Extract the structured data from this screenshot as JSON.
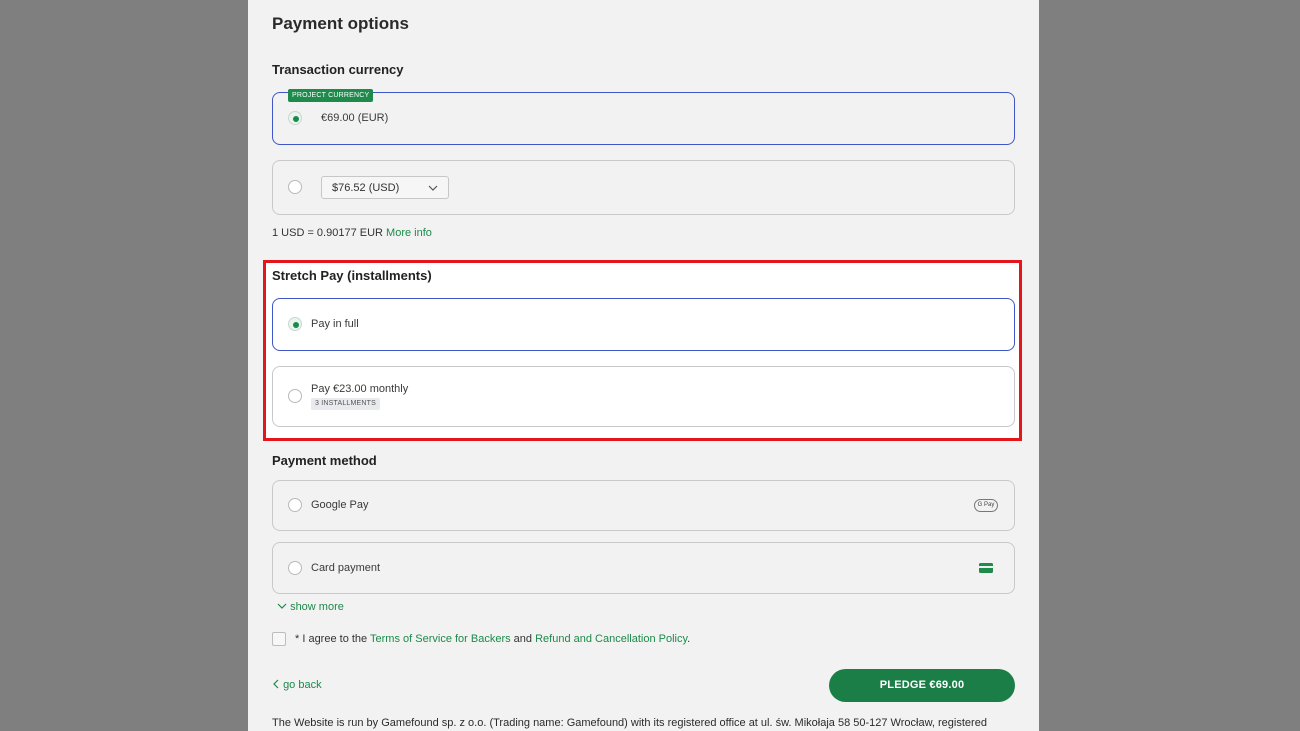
{
  "page": {
    "title": "Payment options",
    "transaction_currency": {
      "heading": "Transaction currency",
      "project_badge": "PROJECT CURRENCY",
      "option_eur": "€69.00 (EUR)",
      "option_usd_selected": "$76.52 (USD)",
      "rate_text": "1 USD = 0.90177 EUR",
      "more_info": "More info"
    },
    "stretch_pay": {
      "heading": "Stretch Pay (installments)",
      "full": "Pay in full",
      "monthly": "Pay €23.00 monthly",
      "installments_badge": "3 INSTALLMENTS"
    },
    "payment_method": {
      "heading": "Payment method",
      "google_pay": "Google Pay",
      "gpay_icon_text": "G Pay",
      "card_payment": "Card payment",
      "show_more": "show more"
    },
    "agreement": {
      "prefix": "* I agree to the ",
      "tos": "Terms of Service for Backers",
      "and": " and ",
      "refund": "Refund and Cancellation Policy",
      "suffix": "."
    },
    "actions": {
      "go_back": "go back",
      "pledge": "PLEDGE €69.00"
    },
    "footer": "The Website is run by Gamefound sp. z o.o. (Trading name: Gamefound) with its registered office at ul. św. Mikołaja 58 50-127 Wrocław, registered"
  },
  "colors": {
    "accent_green": "#1c7e47",
    "selected_border": "#3f55c8",
    "highlight_red": "#e3161b"
  }
}
